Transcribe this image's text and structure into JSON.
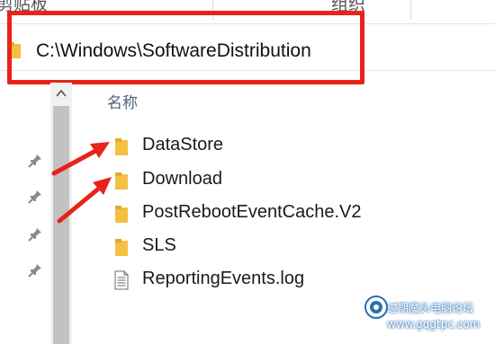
{
  "ribbon": {
    "clipboard_label": "剪贴板",
    "organize_label": "组织"
  },
  "address_bar": {
    "path": "C:\\Windows\\SoftwareDistribution"
  },
  "file_list": {
    "column_header": "名称",
    "items": [
      {
        "name": "DataStore",
        "icon": "folder-icon"
      },
      {
        "name": "Download",
        "icon": "folder-icon"
      },
      {
        "name": "PostRebootEventCache.V2",
        "icon": "folder-icon"
      },
      {
        "name": "SLS",
        "icon": "folder-icon"
      },
      {
        "name": "ReportingEvents.log",
        "icon": "text-file-icon"
      }
    ]
  },
  "watermark": {
    "site_name": "过期魔头电脑论坛",
    "url": "www.gqgtpc.com"
  },
  "colors": {
    "highlight_red": "#e8231a",
    "folder_yellow": "#f3c042",
    "header_text": "#4c607a"
  }
}
